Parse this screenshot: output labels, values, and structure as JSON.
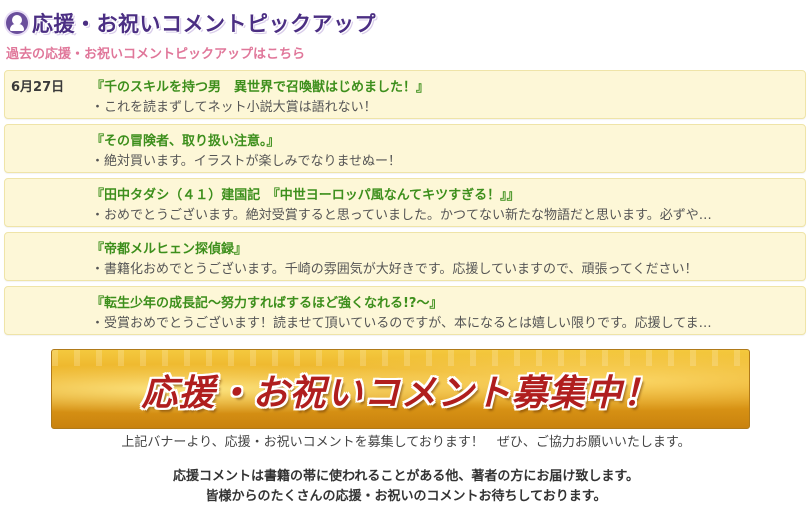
{
  "header": {
    "icon": "person-icon",
    "title": "応援・お祝いコメントピックアップ",
    "past_link": "過去の応援・お祝いコメントピックアップはこちら"
  },
  "entries": [
    {
      "date": "6月27日",
      "title": "『千のスキルを持つ男　異世界で召喚獣はじめました！』",
      "comment": "・これを読まずしてネット小説大賞は語れない！"
    },
    {
      "date": "",
      "title": "『その冒険者、取り扱い注意。』",
      "comment": "・絶対買います。イラストが楽しみでなりませぬー！"
    },
    {
      "date": "",
      "title": "『田中タダシ（４１）建国記　『中世ヨーロッパ風なんてキツすぎる！』』",
      "comment": "・おめでとうございます。絶対受賞すると思っていました。かつてない新たな物語だと思います。必ずや…"
    },
    {
      "date": "",
      "title": "『帝都メルヒェン探偵録』",
      "comment": "・書籍化おめでとうございます。千崎の雰囲気が大好きです。応援していますので、頑張ってください！"
    },
    {
      "date": "",
      "title": "『転生少年の成長記～努力すればするほど強くなれる!?～』",
      "comment": "・受賞おめでとうございます！読ませて頂いているのですが、本になるとは嬉しい限りです。応援してま…"
    }
  ],
  "banner": {
    "text": "応援・お祝いコメント募集中！"
  },
  "notes": {
    "line1": "上記バナーより、応援・お祝いコメントを募集しております！　ぜひ、ご協力お願いいたします。",
    "line2": "応援コメントは書籍の帯に使われることがある他、著者の方にお届け致します。",
    "line3": "皆様からのたくさんの応援・お祝いのコメントお待ちしております。"
  },
  "colors": {
    "title": "#4b2e83",
    "link": "#e0779a",
    "book_title": "#3d8f1c",
    "card_bg": "#fdf7d7",
    "banner_text": "#b01e1e"
  }
}
